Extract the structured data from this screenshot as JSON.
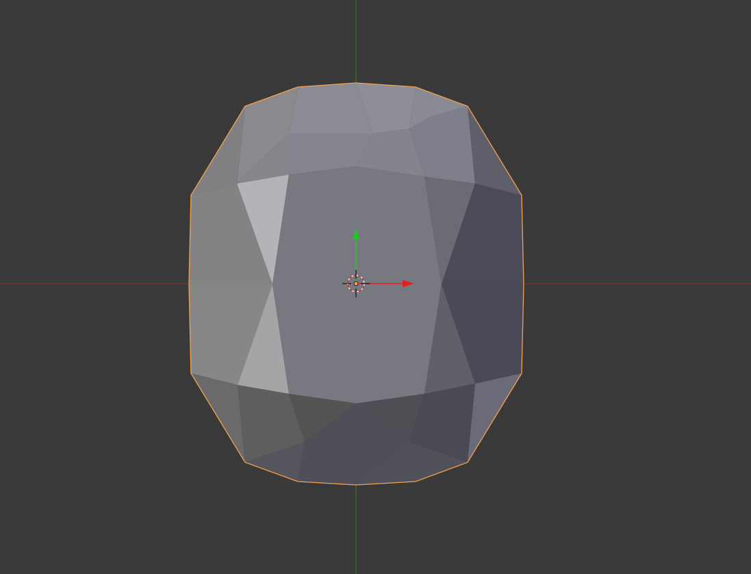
{
  "viewport": {
    "view": "front-orthographic",
    "object": "mesh",
    "object_selected": true,
    "grid_visible": true,
    "axes_visible": [
      "x",
      "z"
    ]
  },
  "colors": {
    "background": "#393939",
    "grid_line": "#414141",
    "x_axis": "#8a3030",
    "z_axis": "#3f7a2d",
    "selection_outline": "#f3a24d",
    "gizmo_x": "#e81e1e",
    "gizmo_y": "#22c322",
    "mesh_base": "#7a7a82"
  },
  "icons": {
    "cursor": "3d-cursor-icon",
    "gizmo": "transform-gizmo-icon",
    "origin": "object-origin-icon"
  }
}
